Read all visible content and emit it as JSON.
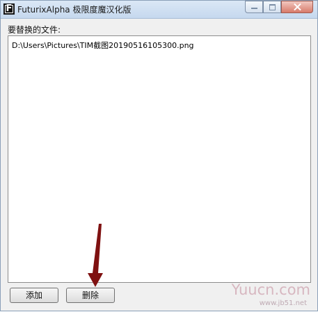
{
  "window": {
    "title": "FuturixAlpha 极限度魔汉化版",
    "app_icon_letter": "F"
  },
  "main": {
    "label": "要替换的文件:",
    "files": [
      "D:\\Users\\Pictures\\TIM截图20190516105300.png"
    ]
  },
  "buttons": {
    "add_label": "添加",
    "delete_label": "删除"
  },
  "watermark": {
    "text": "Yuucn.com",
    "sub": "www.jb51.net"
  },
  "colors": {
    "arrow": "#7f1111",
    "watermark": "#d7b7c0"
  },
  "icons": [
    "minimize-icon",
    "maximize-icon",
    "close-icon",
    "down-arrow-icon"
  ]
}
